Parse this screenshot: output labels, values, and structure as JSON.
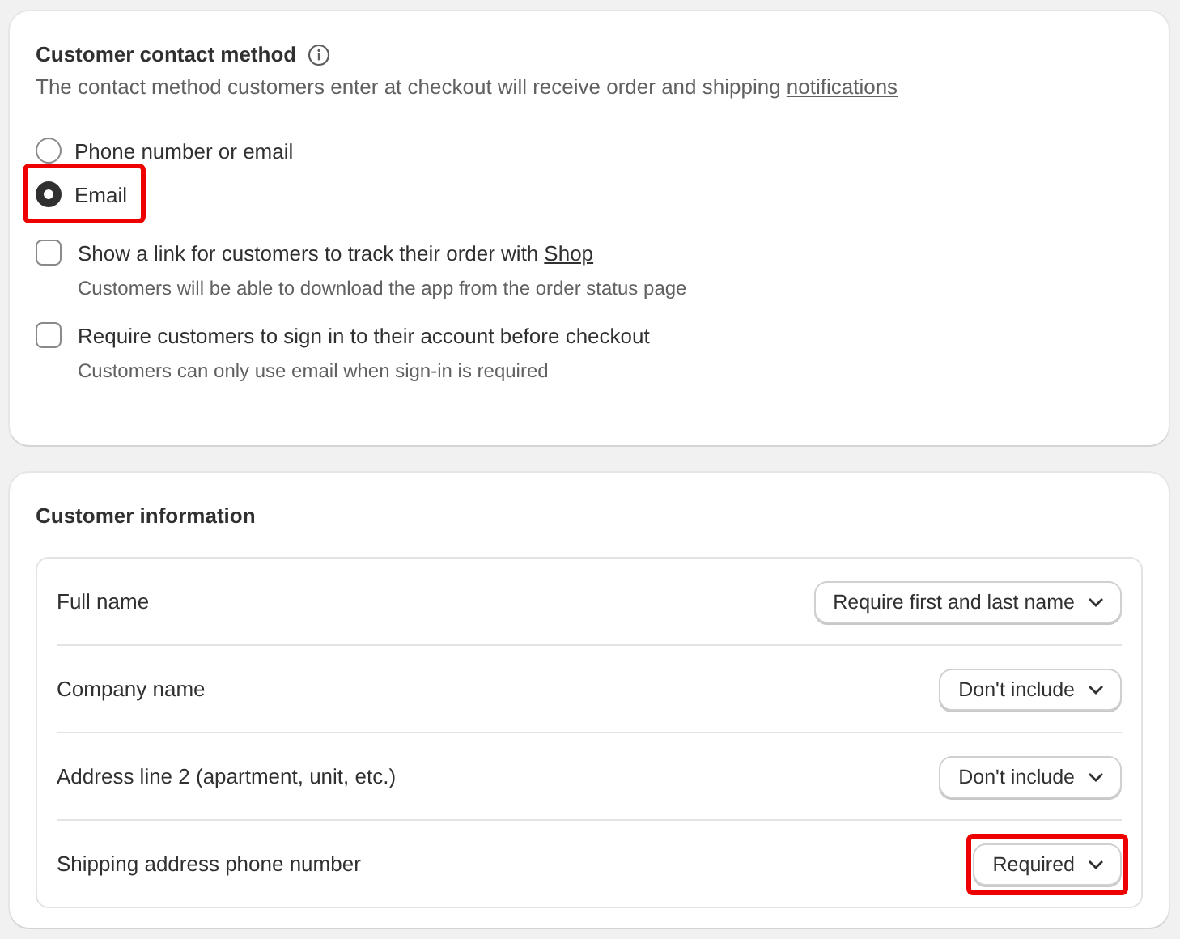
{
  "contact": {
    "title": "Customer contact method",
    "description": "The contact method customers enter at checkout will receive order and shipping",
    "description_link": "notifications",
    "options": [
      {
        "label": "Phone number or email",
        "selected": false,
        "highlighted": false
      },
      {
        "label": "Email",
        "selected": true,
        "highlighted": true
      }
    ],
    "checkboxes": [
      {
        "label": "Show a link for customers to track their order with",
        "link": "Shop",
        "help": "Customers will be able to download the app from the order status page",
        "checked": false
      },
      {
        "label": "Require customers to sign in to their account before checkout",
        "help": "Customers can only use email when sign-in is required",
        "checked": false
      }
    ]
  },
  "info": {
    "title": "Customer information",
    "rows": [
      {
        "label": "Full name",
        "value": "Require first and last name",
        "highlighted": false
      },
      {
        "label": "Company name",
        "value": "Don't include",
        "highlighted": false
      },
      {
        "label": "Address line 2 (apartment, unit, etc.)",
        "value": "Don't include",
        "highlighted": false
      },
      {
        "label": "Shipping address phone number",
        "value": "Required",
        "highlighted": true
      }
    ]
  }
}
